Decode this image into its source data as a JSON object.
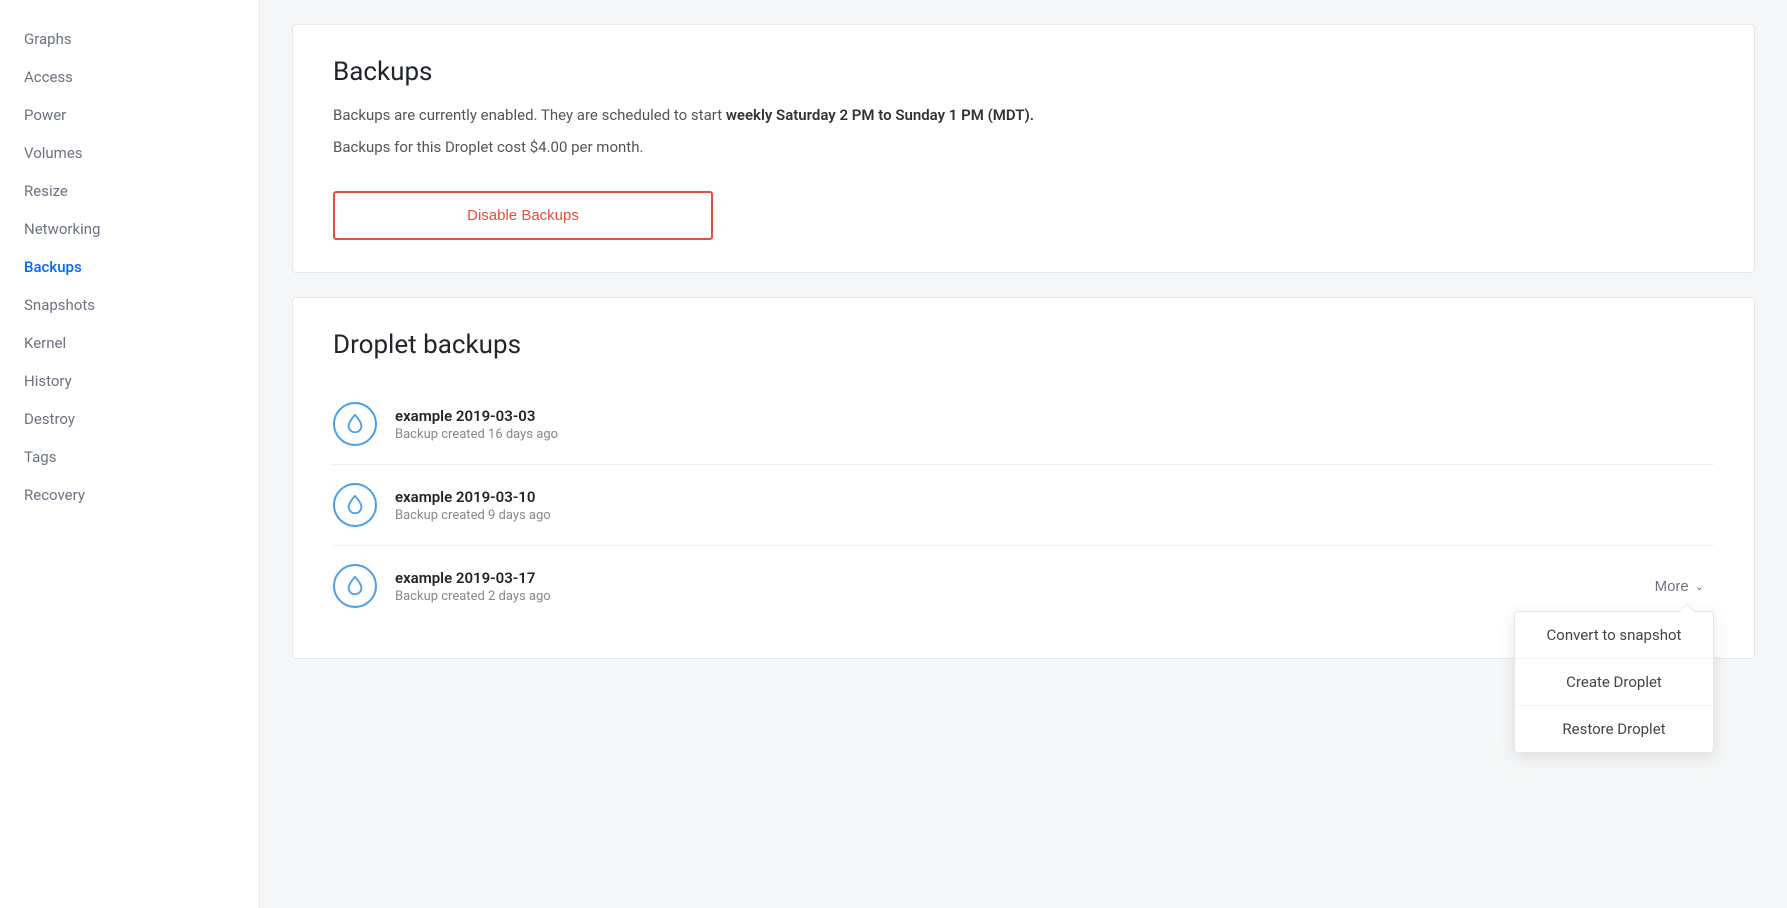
{
  "sidebar": {
    "items": [
      {
        "label": "Graphs",
        "id": "graphs",
        "active": false
      },
      {
        "label": "Access",
        "id": "access",
        "active": false
      },
      {
        "label": "Power",
        "id": "power",
        "active": false
      },
      {
        "label": "Volumes",
        "id": "volumes",
        "active": false
      },
      {
        "label": "Resize",
        "id": "resize",
        "active": false
      },
      {
        "label": "Networking",
        "id": "networking",
        "active": false
      },
      {
        "label": "Backups",
        "id": "backups",
        "active": true
      },
      {
        "label": "Snapshots",
        "id": "snapshots",
        "active": false
      },
      {
        "label": "Kernel",
        "id": "kernel",
        "active": false
      },
      {
        "label": "History",
        "id": "history",
        "active": false
      },
      {
        "label": "Destroy",
        "id": "destroy",
        "active": false
      },
      {
        "label": "Tags",
        "id": "tags",
        "active": false
      },
      {
        "label": "Recovery",
        "id": "recovery",
        "active": false
      }
    ]
  },
  "backups_section": {
    "title": "Backups",
    "info_line1_prefix": "Backups are currently enabled. They are scheduled to start",
    "info_line1_bold": "weekly Saturday 2 PM to Sunday 1 PM (MDT).",
    "info_line2": "Backups for this Droplet cost $4.00 per month.",
    "disable_button": "Disable Backups"
  },
  "droplet_backups_section": {
    "title": "Droplet backups",
    "backups": [
      {
        "name": "example 2019-03-03",
        "age": "Backup created 16 days ago"
      },
      {
        "name": "example 2019-03-10",
        "age": "Backup created 9 days ago"
      },
      {
        "name": "example 2019-03-17",
        "age": "Backup created 2 days ago"
      }
    ],
    "more_button": "More",
    "dropdown_items": [
      {
        "label": "Convert to snapshot",
        "id": "convert-to-snapshot"
      },
      {
        "label": "Create Droplet",
        "id": "create-droplet"
      },
      {
        "label": "Restore Droplet",
        "id": "restore-droplet"
      }
    ]
  }
}
